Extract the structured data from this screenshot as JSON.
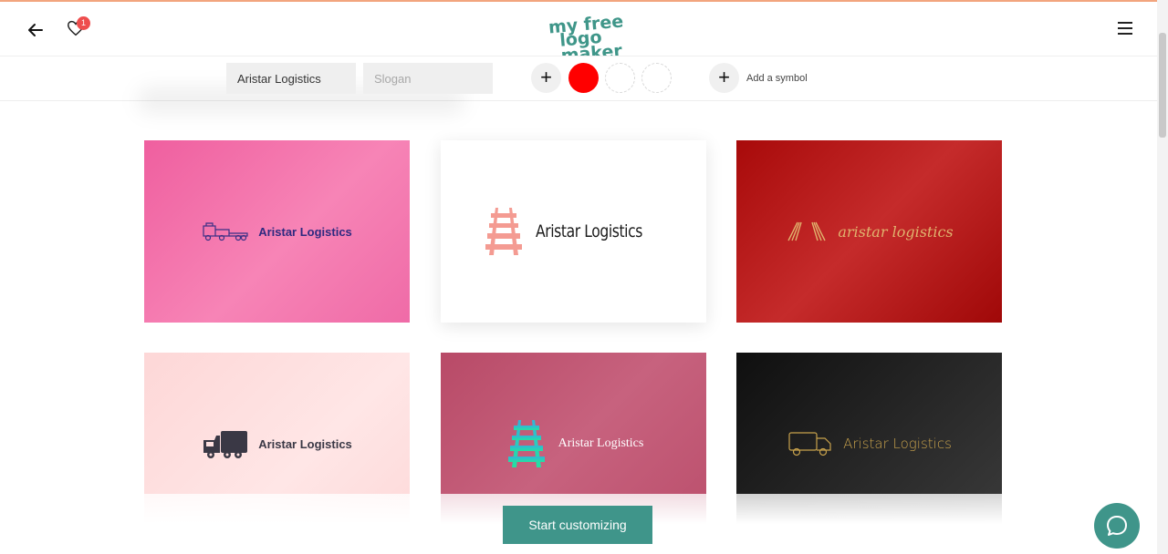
{
  "header": {
    "logo_line1": "my free",
    "logo_line2": "logo maker",
    "favorites_count": "1",
    "back_icon": "arrow-left-icon",
    "favorites_icon": "heart-icon",
    "menu_icon": "hamburger-menu-icon"
  },
  "toolbar": {
    "company_name_value": "Aristar Logistics",
    "slogan_placeholder": "Slogan",
    "add_color_label": "+",
    "add_symbol_button": "+",
    "add_symbol_label": "Add a symbol",
    "selected_color": "#ff0000"
  },
  "cards": [
    {
      "text": "Aristar Logistics",
      "icon": "truck-trailer-icon",
      "bg": "#f278ad",
      "text_color": "#2e2a80"
    },
    {
      "text": "Aristar Logistics",
      "icon": "railway-track-icon",
      "bg": "#ffffff",
      "text_color": "#1a1a1a",
      "icon_color": "#f49b92"
    },
    {
      "text": "aristar logistics",
      "icon": "converging-lines-icon",
      "bg": "#b31212",
      "text_color": "#e0b36e"
    },
    {
      "text": "Aristar Logistics",
      "icon": "truck-icon",
      "bg": "#fde0e0",
      "text_color": "#3a3845"
    },
    {
      "text": "Aristar Logistics",
      "icon": "railway-track-icon",
      "bg": "#bf5470",
      "text_color": "#ffffff"
    },
    {
      "text": "Aristar Logistics",
      "icon": "delivery-truck-icon",
      "bg": "#1e1e1e",
      "text_color": "#c8a24c"
    }
  ],
  "cta": {
    "label": "Start customizing"
  },
  "chat": {
    "icon": "chat-bubble-icon"
  },
  "colors": {
    "accent": "#3f958a",
    "badge": "#ee4d4d"
  }
}
